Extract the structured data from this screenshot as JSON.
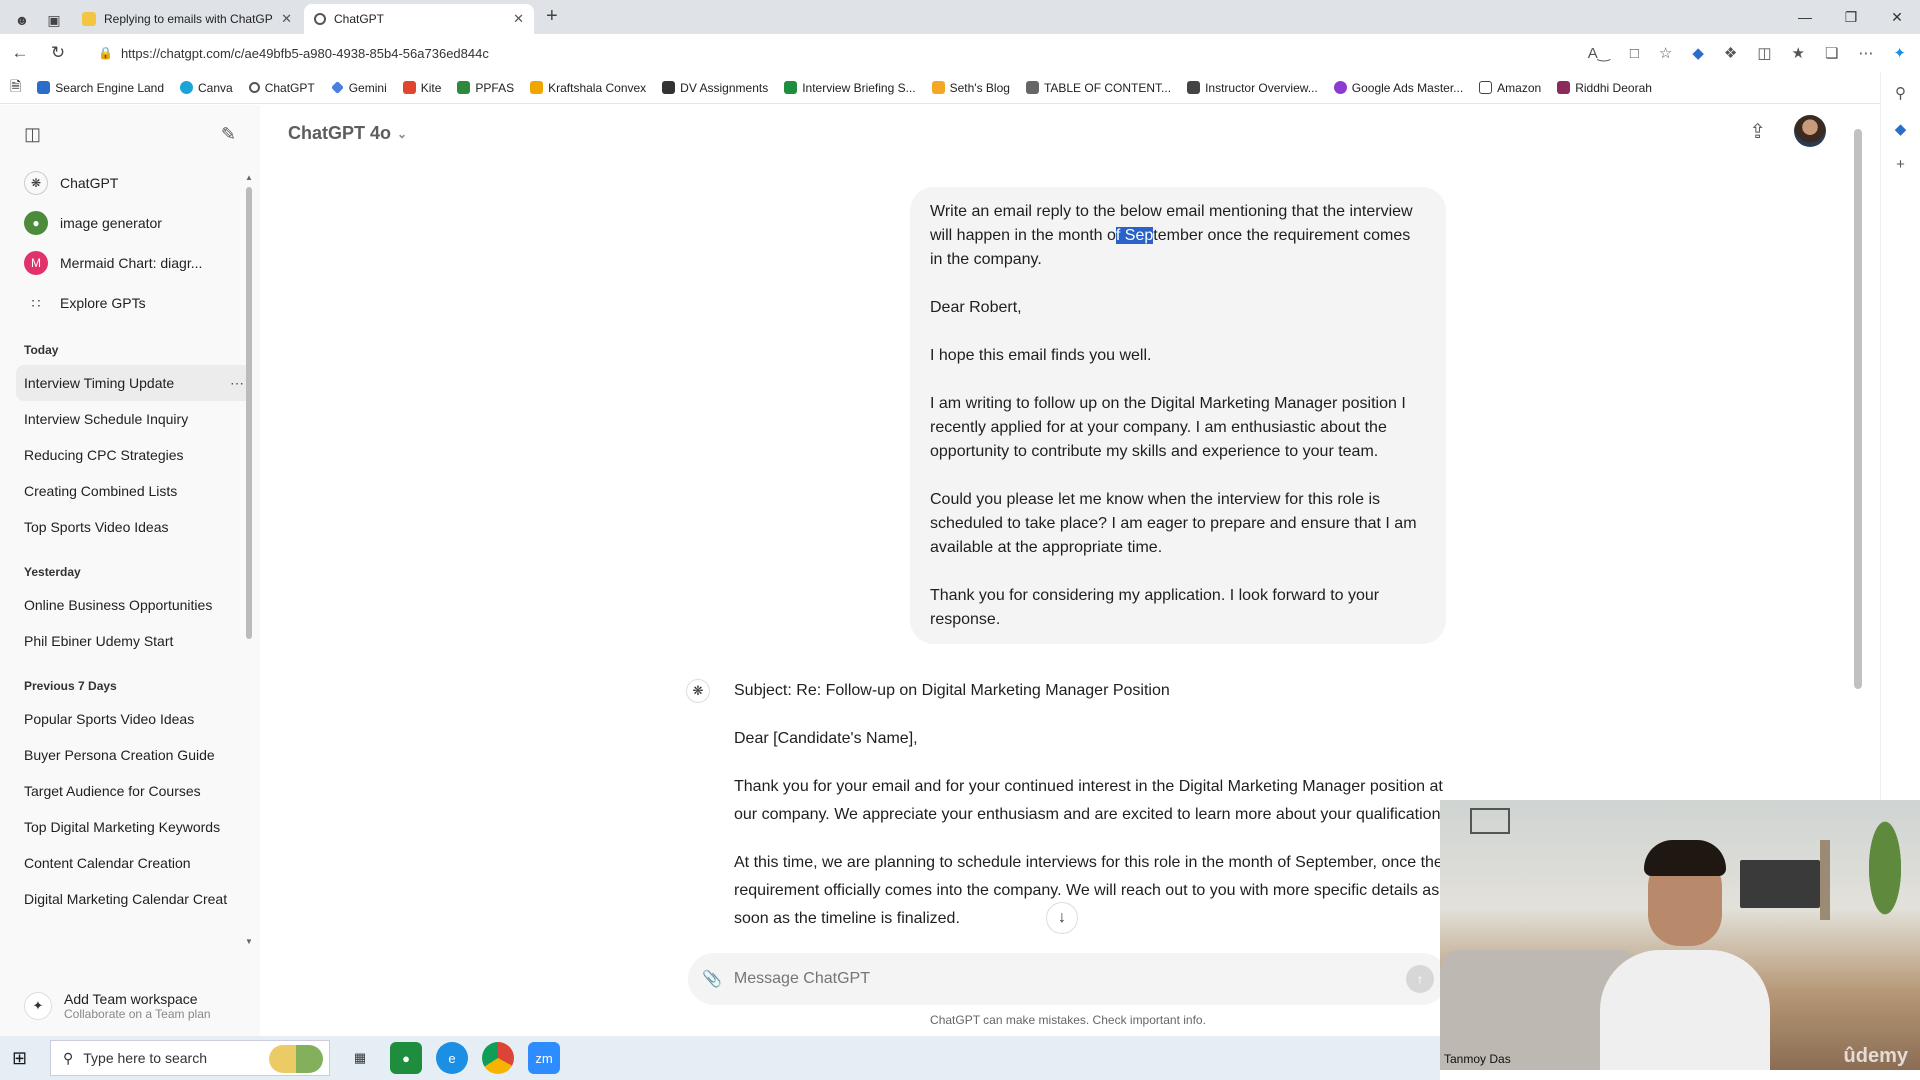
{
  "browser": {
    "tabs": [
      {
        "title": "Replying to emails with ChatGPT",
        "active": false,
        "favicon_color": "#f4c542"
      },
      {
        "title": "ChatGPT",
        "active": true,
        "favicon_color": "#555555"
      }
    ],
    "url": "https://chatgpt.com/c/ae49bfb5-a980-4938-85b4-56a736ed844c",
    "bookmarks": [
      {
        "label": "Search Engine Land",
        "color": "#2a6ec9"
      },
      {
        "label": "Canva",
        "color": "#1aa5d6"
      },
      {
        "label": "ChatGPT",
        "color": "#555555"
      },
      {
        "label": "Gemini",
        "color": "#4a7fe0"
      },
      {
        "label": "Kite",
        "color": "#e2452e"
      },
      {
        "label": "PPFAS",
        "color": "#2b8a3e"
      },
      {
        "label": "Kraftshala Convex",
        "color": "#f0a500"
      },
      {
        "label": "DV Assignments",
        "color": "#333333"
      },
      {
        "label": "Interview Briefing S...",
        "color": "#1e8e3e"
      },
      {
        "label": "Seth's Blog",
        "color": "#f5a623"
      },
      {
        "label": "TABLE OF CONTENT...",
        "color": "#666666"
      },
      {
        "label": "Instructor Overview...",
        "color": "#444444"
      },
      {
        "label": "Google Ads Master...",
        "color": "#8b3bd1"
      },
      {
        "label": "Amazon",
        "color": "#444444"
      },
      {
        "label": "Riddhi Deorah",
        "color": "#8a2b5a"
      }
    ]
  },
  "sidebar": {
    "gpts": [
      {
        "label": "ChatGPT",
        "icon": "chatgpt-icon",
        "color": "#ffffff"
      },
      {
        "label": "image generator",
        "icon": "image-generator-icon",
        "color": "#4b8b3b"
      },
      {
        "label": "Mermaid Chart: diagr...",
        "icon": "mermaid-icon",
        "color": "#e0336b"
      },
      {
        "label": "Explore GPTs",
        "icon": "grid-icon",
        "color": "#ffffff"
      }
    ],
    "sections": [
      {
        "heading": "Today",
        "items": [
          "Interview Timing Update",
          "Interview Schedule Inquiry",
          "Reducing CPC Strategies",
          "Creating Combined Lists",
          "Top Sports Video Ideas"
        ]
      },
      {
        "heading": "Yesterday",
        "items": [
          "Online Business Opportunities",
          "Phil Ebiner Udemy Start"
        ]
      },
      {
        "heading": "Previous 7 Days",
        "items": [
          "Popular Sports Video Ideas",
          "Buyer Persona Creation Guide",
          "Target Audience for Courses",
          "Top Digital Marketing Keywords",
          "Content Calendar Creation",
          "Digital Marketing Calendar Creat"
        ]
      }
    ],
    "team": {
      "title": "Add Team workspace",
      "subtitle": "Collaborate on a Team plan"
    }
  },
  "header": {
    "model": "ChatGPT 4o"
  },
  "user_message": {
    "line1_before": "Write an email reply to the below email mentioning that the interview will happen in the month o",
    "line1_highlight": "f Sep",
    "line1_after": "tember once the requirement comes in the company.",
    "greeting": "Dear Robert,",
    "p1": "I hope this email finds you well.",
    "p2": "I am writing to follow up on the Digital Marketing Manager position I recently applied for at your company. I am enthusiastic about the opportunity to contribute my skills and experience to your team.",
    "p3": "Could you please let me know when the interview for this role is scheduled to take place? I am eager to prepare and ensure that I am available at the appropriate time.",
    "p4": "Thank you for considering my application. I look forward to your response."
  },
  "assistant_message": {
    "subject": "Subject: Re: Follow-up on Digital Marketing Manager Position",
    "greeting": "Dear [Candidate's Name],",
    "p1": "Thank you for your email and for your continued interest in the Digital Marketing Manager position at our company. We appreciate your enthusiasm and are excited to learn more about your qualifications.",
    "p2": "At this time, we are planning to schedule interviews for this role in the month of September, once the requirement officially comes into the company. We will reach out to you with more specific details as soon as the timeline is finalized."
  },
  "composer": {
    "placeholder": "Message ChatGPT"
  },
  "disclaimer": "ChatGPT can make mistakes. Check important info.",
  "webcam": {
    "name": "Tanmoy Das",
    "watermark": "ûdemy"
  },
  "taskbar": {
    "search_placeholder": "Type here to search"
  }
}
